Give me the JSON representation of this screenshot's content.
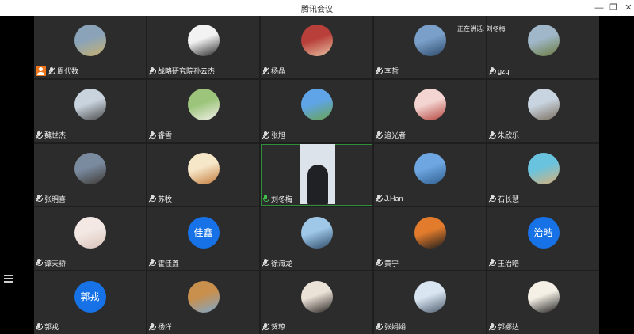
{
  "window": {
    "title": "腾讯会议",
    "controls": [
      "minimize-icon",
      "maximize-icon",
      "close-icon"
    ]
  },
  "speaking_note": "正在讲话: 刘冬梅;",
  "participants": [
    {
      "name": "周代数",
      "host": true,
      "avatar": "photo",
      "colors": [
        "#8aa3b9",
        "#c8b16e"
      ]
    },
    {
      "name": "战略研究院孙云杰",
      "avatar": "photo",
      "colors": [
        "#f2f2f2",
        "#2a2a2a"
      ]
    },
    {
      "name": "杨晶",
      "avatar": "photo",
      "colors": [
        "#b83f3a",
        "#e8c1a2"
      ]
    },
    {
      "name": "李哲",
      "avatar": "photo",
      "colors": [
        "#7aa0c9",
        "#2d4a6b"
      ]
    },
    {
      "name": "gzq",
      "avatar": "photo",
      "colors": [
        "#9fb7c8",
        "#6c7b3f"
      ]
    },
    {
      "name": "魏世杰",
      "avatar": "photo",
      "colors": [
        "#c9d3de",
        "#4a4a4a"
      ]
    },
    {
      "name": "睿雪",
      "avatar": "photo",
      "colors": [
        "#9cc57b",
        "#f3f0ea"
      ]
    },
    {
      "name": "张旭",
      "avatar": "photo",
      "colors": [
        "#5fa4e6",
        "#6aa34d"
      ]
    },
    {
      "name": "追光者",
      "avatar": "photo",
      "colors": [
        "#f4d4d1",
        "#b3433b"
      ]
    },
    {
      "name": "朱欣乐",
      "avatar": "photo",
      "colors": [
        "#c8d4e0",
        "#7a6d5c"
      ]
    },
    {
      "name": "张明喜",
      "avatar": "photo",
      "colors": [
        "#7a8ba0",
        "#3e3a34"
      ]
    },
    {
      "name": "苏牧",
      "avatar": "photo",
      "colors": [
        "#f6e7c8",
        "#c47b3c"
      ]
    },
    {
      "name": "刘冬梅",
      "avatar": "video",
      "speaking": true,
      "colors": [
        "#dde3ea",
        "#1f2124"
      ]
    },
    {
      "name": "J.Han",
      "avatar": "photo",
      "colors": [
        "#6ea6e2",
        "#2f5f8e"
      ]
    },
    {
      "name": "石长慧",
      "avatar": "photo",
      "colors": [
        "#69c3de",
        "#d9b07a"
      ]
    },
    {
      "name": "谭天骄",
      "avatar": "photo",
      "colors": [
        "#f3e8e3",
        "#d9c2b8"
      ]
    },
    {
      "name": "霍佳鑫",
      "avatar": "text",
      "avatar_text": "佳鑫"
    },
    {
      "name": "徐海龙",
      "avatar": "photo",
      "colors": [
        "#9ec7e8",
        "#2f4c69"
      ]
    },
    {
      "name": "黄宁",
      "avatar": "photo",
      "colors": [
        "#e27c2c",
        "#1d1d1d"
      ]
    },
    {
      "name": "王治晧",
      "avatar": "text",
      "avatar_text": "治晧"
    },
    {
      "name": "郭戎",
      "avatar": "text",
      "avatar_text": "郭戎"
    },
    {
      "name": "杨洋",
      "avatar": "photo",
      "colors": [
        "#c98f4d",
        "#7fa7c9"
      ]
    },
    {
      "name": "贺琼",
      "avatar": "photo",
      "colors": [
        "#eae2d7",
        "#2a2523"
      ]
    },
    {
      "name": "张娟娟",
      "avatar": "photo",
      "colors": [
        "#d9e6f2",
        "#4d5b6c"
      ]
    },
    {
      "name": "郭娜达",
      "avatar": "photo",
      "colors": [
        "#f5f0e6",
        "#222222"
      ]
    }
  ]
}
